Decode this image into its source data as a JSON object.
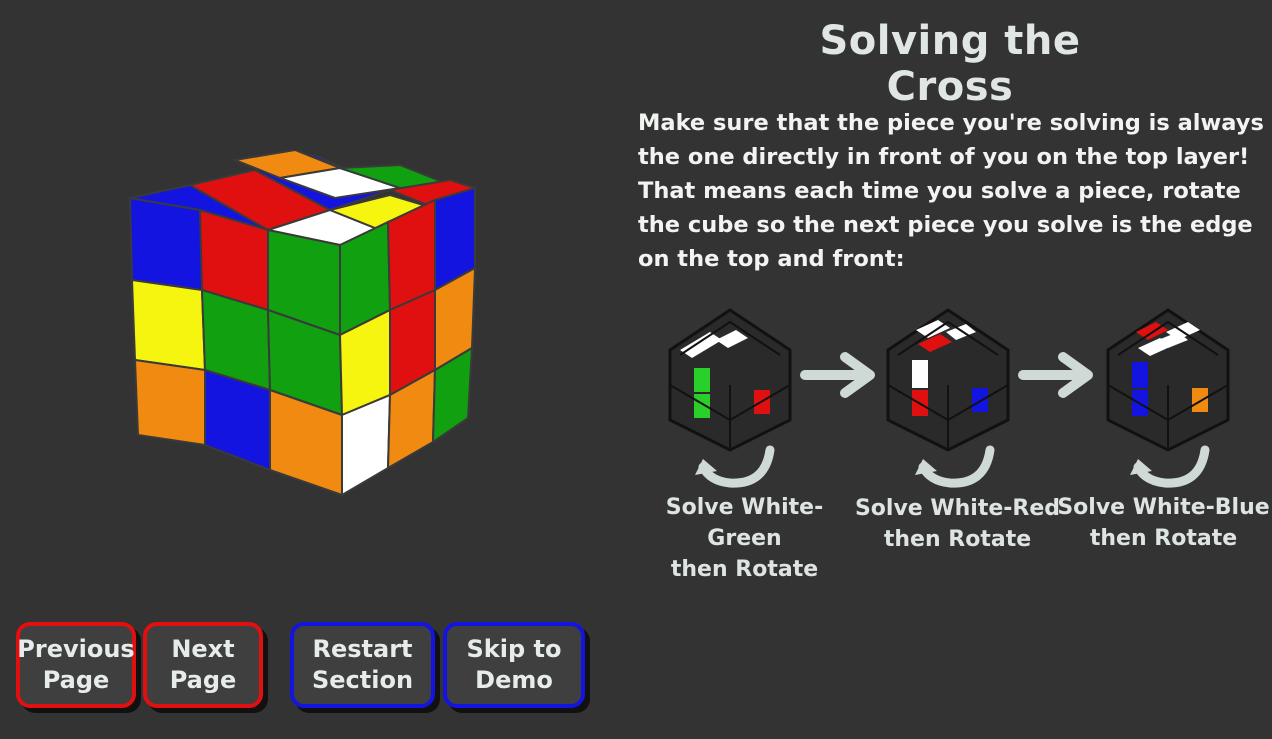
{
  "title": "Solving the Cross",
  "instructions": "Make sure that the piece you're solving is always the one directly in front of you on the top layer! That means each time you solve a piece, rotate the cube so the next piece you solve is the edge on the top and front:",
  "steps": [
    {
      "caption": "Solve White-Green\nthen Rotate",
      "front_sticker": "#2ad02a",
      "right_sticker": "#e01010"
    },
    {
      "caption": "Solve White-Red\nthen Rotate",
      "front_sticker": "#e01010",
      "right_sticker": "#1414e0"
    },
    {
      "caption": "Solve White-Blue\nthen Rotate",
      "front_sticker": "#1414e0",
      "right_sticker": "#f08a10"
    }
  ],
  "buttons": {
    "previous": "Previous\nPage",
    "next": "Next\nPage",
    "restart": "Restart\nSection",
    "skip": "Skip to\nDemo"
  },
  "colors": {
    "background": "#333333",
    "nav_border": "#e01010",
    "section_border": "#1414e0"
  }
}
